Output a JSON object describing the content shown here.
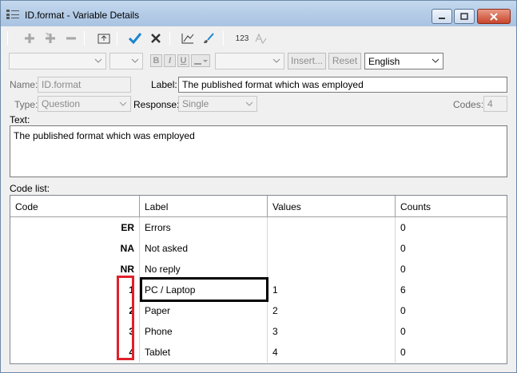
{
  "window": {
    "title": "ID.format - Variable Details"
  },
  "toolbar": {
    "icons": [
      "plus-icon",
      "insert-plus-icon",
      "minus-icon",
      "up-level-icon",
      "check-icon",
      "close-x-icon",
      "chart-edit-icon",
      "brush-icon",
      "numeric-123-icon",
      "spell-check-icon"
    ],
    "numeric_label": "123"
  },
  "format_bar": {
    "bold": "B",
    "italic": "I",
    "underline": "U",
    "insert_label": "Insert...",
    "reset_label": "Reset",
    "language": "English"
  },
  "form": {
    "name_label": "Name:",
    "name_value": "ID.format",
    "label_label": "Label:",
    "label_value": "The published format which was employed",
    "type_label": "Type:",
    "type_value": "Question",
    "response_label": "Response:",
    "response_value": "Single",
    "codes_label": "Codes:",
    "codes_value": "4",
    "text_label": "Text:",
    "text_value": "The published format which was employed"
  },
  "code_list": {
    "title": "Code list:",
    "columns": [
      "Code",
      "Label",
      "Values",
      "Counts"
    ],
    "rows": [
      {
        "code": "ER",
        "label": "Errors",
        "value": "",
        "count": "0"
      },
      {
        "code": "NA",
        "label": "Not asked",
        "value": "",
        "count": "0"
      },
      {
        "code": "NR",
        "label": "No reply",
        "value": "",
        "count": "0"
      },
      {
        "code": "1",
        "label": "PC / Laptop",
        "value": "1",
        "count": "6"
      },
      {
        "code": "2",
        "label": "Paper",
        "value": "2",
        "count": "0"
      },
      {
        "code": "3",
        "label": "Phone",
        "value": "3",
        "count": "0"
      },
      {
        "code": "4",
        "label": "Tablet",
        "value": "4",
        "count": "0"
      }
    ]
  },
  "colors": {
    "highlight_box": "#e0202a",
    "check_blue": "#1a86d0"
  }
}
